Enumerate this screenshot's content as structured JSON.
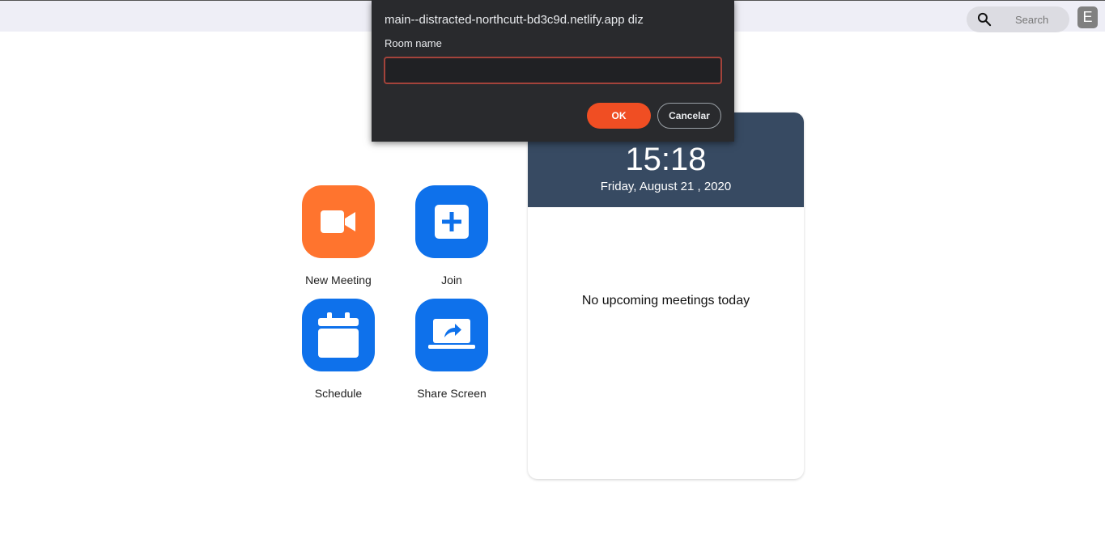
{
  "header": {
    "search_label": "Search",
    "avatar_letter": "E"
  },
  "actions": [
    {
      "label": "New Meeting",
      "icon": "video-camera-icon",
      "color": "#ff742e"
    },
    {
      "label": "Join",
      "icon": "plus-square-icon",
      "color": "#0e71eb"
    },
    {
      "label": "Schedule",
      "icon": "calendar-icon",
      "color": "#0e71eb"
    },
    {
      "label": "Share Screen",
      "icon": "share-screen-icon",
      "color": "#0e71eb"
    }
  ],
  "calendar_card": {
    "time": "15:18",
    "date": "Friday, August 21 , 2020",
    "empty_message": "No upcoming meetings today",
    "header_color": "#374a62"
  },
  "prompt_dialog": {
    "title": "main--distracted-northcutt-bd3c9d.netlify.app diz",
    "label": "Room name",
    "input_value": "",
    "ok_label": "OK",
    "cancel_label": "Cancelar",
    "ok_color": "#f04e23"
  }
}
